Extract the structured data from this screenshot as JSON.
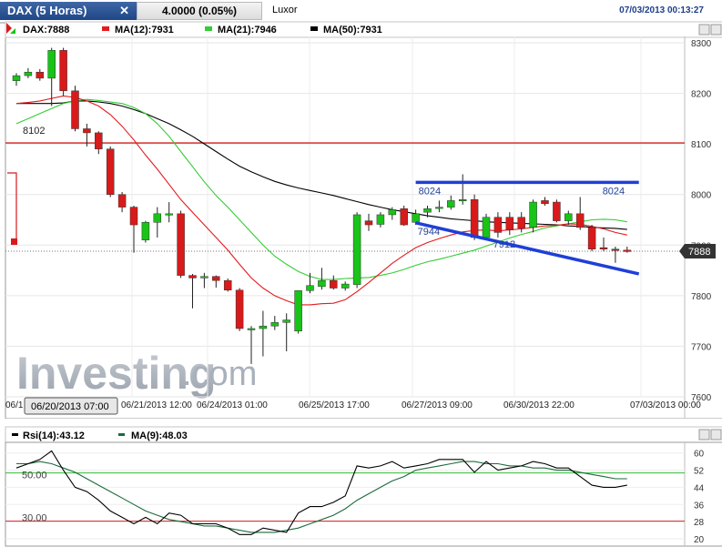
{
  "header": {
    "symbol_tab": "DAX (5 Horas)",
    "close_icon": "close-icon",
    "change": "4.0000 (0.05%)",
    "template_name": "Luxor",
    "timestamp": "07/03/2013 00:13:27"
  },
  "legend": {
    "price": "DAX:7888",
    "ma12": "MA(12):7931",
    "ma21": "MA(21):7946",
    "ma50": "MA(50):7931",
    "ma12_color": "#e41a1c",
    "ma21_color": "#33cc33",
    "ma50_color": "#000000"
  },
  "watermark": {
    "brand": "Investing",
    "suffix": ".com"
  },
  "colors": {
    "up": "#18c418",
    "down": "#d81a1a",
    "trend": "#1f3fd8",
    "level": "#d42020"
  },
  "crosshair_label": "06/20/2013 07:00",
  "chart_data": [
    {
      "type": "candlestick",
      "ylim": [
        7600,
        8300
      ],
      "y_ticks": [
        7600,
        7700,
        7800,
        7900,
        8000,
        8100,
        8200,
        8300
      ],
      "x_tick_labels": [
        "06/1",
        "06/21/2013 12:00",
        "06/24/2013 01:00",
        "06/25/2013 17:00",
        "06/27/2013 09:00",
        "06/30/2013 22:00",
        "07/03/2013 00:00"
      ],
      "last_price_label": "7888",
      "candles": [
        {
          "o": 8225,
          "h": 8240,
          "l": 8215,
          "c": 8235
        },
        {
          "o": 8235,
          "h": 8250,
          "l": 8230,
          "c": 8242
        },
        {
          "o": 8242,
          "h": 8248,
          "l": 8225,
          "c": 8230
        },
        {
          "o": 8230,
          "h": 8290,
          "l": 8175,
          "c": 8285
        },
        {
          "o": 8285,
          "h": 8290,
          "l": 8195,
          "c": 8205
        },
        {
          "o": 8205,
          "h": 8215,
          "l": 8125,
          "c": 8130
        },
        {
          "o": 8130,
          "h": 8140,
          "l": 8095,
          "c": 8122
        },
        {
          "o": 8122,
          "h": 8125,
          "l": 8080,
          "c": 8090
        },
        {
          "o": 8090,
          "h": 8095,
          "l": 7995,
          "c": 8000
        },
        {
          "o": 8000,
          "h": 8005,
          "l": 7965,
          "c": 7975
        },
        {
          "o": 7975,
          "h": 7978,
          "l": 7885,
          "c": 7940
        },
        {
          "o": 7910,
          "h": 7948,
          "l": 7905,
          "c": 7945
        },
        {
          "o": 7945,
          "h": 7975,
          "l": 7915,
          "c": 7962
        },
        {
          "o": 7962,
          "h": 7985,
          "l": 7945,
          "c": 7962
        },
        {
          "o": 7962,
          "h": 7968,
          "l": 7835,
          "c": 7840
        },
        {
          "o": 7840,
          "h": 7843,
          "l": 7775,
          "c": 7835
        },
        {
          "o": 7835,
          "h": 7845,
          "l": 7815,
          "c": 7838
        },
        {
          "o": 7838,
          "h": 7840,
          "l": 7816,
          "c": 7830
        },
        {
          "o": 7830,
          "h": 7834,
          "l": 7808,
          "c": 7811
        },
        {
          "o": 7811,
          "h": 7815,
          "l": 7730,
          "c": 7735
        },
        {
          "o": 7735,
          "h": 7740,
          "l": 7665,
          "c": 7735
        },
        {
          "o": 7735,
          "h": 7770,
          "l": 7680,
          "c": 7740
        },
        {
          "o": 7740,
          "h": 7760,
          "l": 7732,
          "c": 7747
        },
        {
          "o": 7747,
          "h": 7765,
          "l": 7690,
          "c": 7752
        },
        {
          "o": 7730,
          "h": 7810,
          "l": 7725,
          "c": 7810
        },
        {
          "o": 7810,
          "h": 7845,
          "l": 7805,
          "c": 7820
        },
        {
          "o": 7818,
          "h": 7855,
          "l": 7812,
          "c": 7830
        },
        {
          "o": 7830,
          "h": 7840,
          "l": 7812,
          "c": 7815
        },
        {
          "o": 7815,
          "h": 7828,
          "l": 7810,
          "c": 7823
        },
        {
          "o": 7822,
          "h": 7965,
          "l": 7815,
          "c": 7960
        },
        {
          "o": 7948,
          "h": 7962,
          "l": 7928,
          "c": 7940
        },
        {
          "o": 7941,
          "h": 7965,
          "l": 7935,
          "c": 7960
        },
        {
          "o": 7960,
          "h": 7975,
          "l": 7950,
          "c": 7970
        },
        {
          "o": 7972,
          "h": 7978,
          "l": 7938,
          "c": 7940
        },
        {
          "o": 7945,
          "h": 7970,
          "l": 7940,
          "c": 7962
        },
        {
          "o": 7965,
          "h": 7978,
          "l": 7955,
          "c": 7972
        },
        {
          "o": 7975,
          "h": 7988,
          "l": 7965,
          "c": 7975
        },
        {
          "o": 7975,
          "h": 7998,
          "l": 7970,
          "c": 7988
        },
        {
          "o": 7988,
          "h": 8040,
          "l": 7980,
          "c": 7990
        },
        {
          "o": 7990,
          "h": 8000,
          "l": 7910,
          "c": 7915
        },
        {
          "o": 7915,
          "h": 7962,
          "l": 7910,
          "c": 7955
        },
        {
          "o": 7955,
          "h": 7965,
          "l": 7915,
          "c": 7925
        },
        {
          "o": 7955,
          "h": 7965,
          "l": 7920,
          "c": 7930
        },
        {
          "o": 7955,
          "h": 7965,
          "l": 7925,
          "c": 7933
        },
        {
          "o": 7935,
          "h": 7990,
          "l": 7925,
          "c": 7985
        },
        {
          "o": 7988,
          "h": 7995,
          "l": 7978,
          "c": 7982
        },
        {
          "o": 7985,
          "h": 7990,
          "l": 7945,
          "c": 7948
        },
        {
          "o": 7948,
          "h": 7968,
          "l": 7940,
          "c": 7962
        },
        {
          "o": 7962,
          "h": 7995,
          "l": 7930,
          "c": 7935
        },
        {
          "o": 7935,
          "h": 7940,
          "l": 7888,
          "c": 7892
        },
        {
          "o": 7895,
          "h": 7915,
          "l": 7888,
          "c": 7892
        },
        {
          "o": 7892,
          "h": 7897,
          "l": 7865,
          "c": 7890
        },
        {
          "o": 7890,
          "h": 7897,
          "l": 7885,
          "c": 7888
        }
      ],
      "ma12": [
        8180,
        8182,
        8185,
        8190,
        8195,
        8192,
        8185,
        8175,
        8158,
        8135,
        8108,
        8078,
        8050,
        8020,
        7990,
        7965,
        7940,
        7915,
        7890,
        7862,
        7835,
        7815,
        7800,
        7790,
        7782,
        7782,
        7784,
        7785,
        7792,
        7808,
        7826,
        7845,
        7864,
        7880,
        7895,
        7905,
        7913,
        7920,
        7926,
        7929,
        7930,
        7928,
        7930,
        7932,
        7935,
        7938,
        7939,
        7942,
        7941,
        7937,
        7932,
        7925,
        7920
      ],
      "ma21": [
        8140,
        8150,
        8160,
        8170,
        8180,
        8185,
        8188,
        8186,
        8183,
        8180,
        8172,
        8160,
        8140,
        8115,
        8085,
        8055,
        8025,
        7998,
        7975,
        7950,
        7925,
        7900,
        7878,
        7862,
        7848,
        7838,
        7832,
        7832,
        7834,
        7835,
        7836,
        7840,
        7845,
        7852,
        7860,
        7867,
        7872,
        7878,
        7884,
        7890,
        7898,
        7906,
        7914,
        7921,
        7927,
        7934,
        7938,
        7942,
        7946,
        7950,
        7951,
        7950,
        7946
      ],
      "ma50": [
        8180,
        8180,
        8180,
        8180,
        8181,
        8185,
        8185,
        8183,
        8180,
        8175,
        8168,
        8160,
        8150,
        8140,
        8128,
        8115,
        8100,
        8085,
        8070,
        8056,
        8045,
        8035,
        8026,
        8019,
        8013,
        8008,
        8003,
        7998,
        7992,
        7986,
        7980,
        7975,
        7970,
        7966,
        7962,
        7958,
        7955,
        7952,
        7950,
        7948,
        7946,
        7945,
        7944,
        7943,
        7942,
        7941,
        7940,
        7938,
        7937,
        7935,
        7934,
        7933,
        7931
      ],
      "h_line": {
        "value": 8102,
        "label": "8102"
      },
      "resistance": {
        "value": 8024,
        "label_left": "8024",
        "label_right": "8024",
        "from_candle": 34,
        "to_candle": 53
      },
      "support": {
        "start_candle": 34,
        "start_value": 7944,
        "end_candle": 53,
        "end_value": 7843,
        "label_start": "7944",
        "label_mid": "7912"
      }
    },
    {
      "type": "line",
      "title": "Rsi(14):43.12",
      "ma_title": "MA(9):48.03",
      "rsi_color": "#000000",
      "ma_color": "#1b6b3b",
      "ylim": [
        20,
        62
      ],
      "y_ticks_right": [
        20,
        28,
        36,
        44,
        52,
        60
      ],
      "y_ticks_left": [
        "50.00",
        "30.00"
      ],
      "level_green": 50.7,
      "level_red": 28.2,
      "rsi": [
        53,
        55,
        57,
        61,
        52,
        44,
        42,
        38,
        33,
        30,
        27,
        30,
        27,
        32,
        31,
        27,
        27,
        27,
        25,
        22,
        22,
        25,
        24,
        23,
        32,
        35,
        35,
        37,
        40,
        54,
        53,
        54,
        56,
        53,
        54,
        55,
        57,
        57,
        57,
        51,
        56,
        52,
        53,
        54,
        56,
        55,
        53,
        53,
        49,
        45,
        44,
        44,
        45
      ],
      "ma": [
        55,
        55,
        56,
        55,
        53,
        51,
        48,
        45,
        42,
        39,
        36,
        33,
        31,
        29,
        28,
        27,
        26,
        26,
        25,
        24,
        23,
        23,
        23,
        24,
        25,
        27,
        29,
        31,
        34,
        38,
        41,
        44,
        47,
        49,
        52,
        53,
        54,
        55,
        56,
        56,
        55,
        55,
        54,
        54,
        53,
        53,
        52,
        52,
        51,
        50,
        49,
        48,
        48
      ]
    }
  ]
}
